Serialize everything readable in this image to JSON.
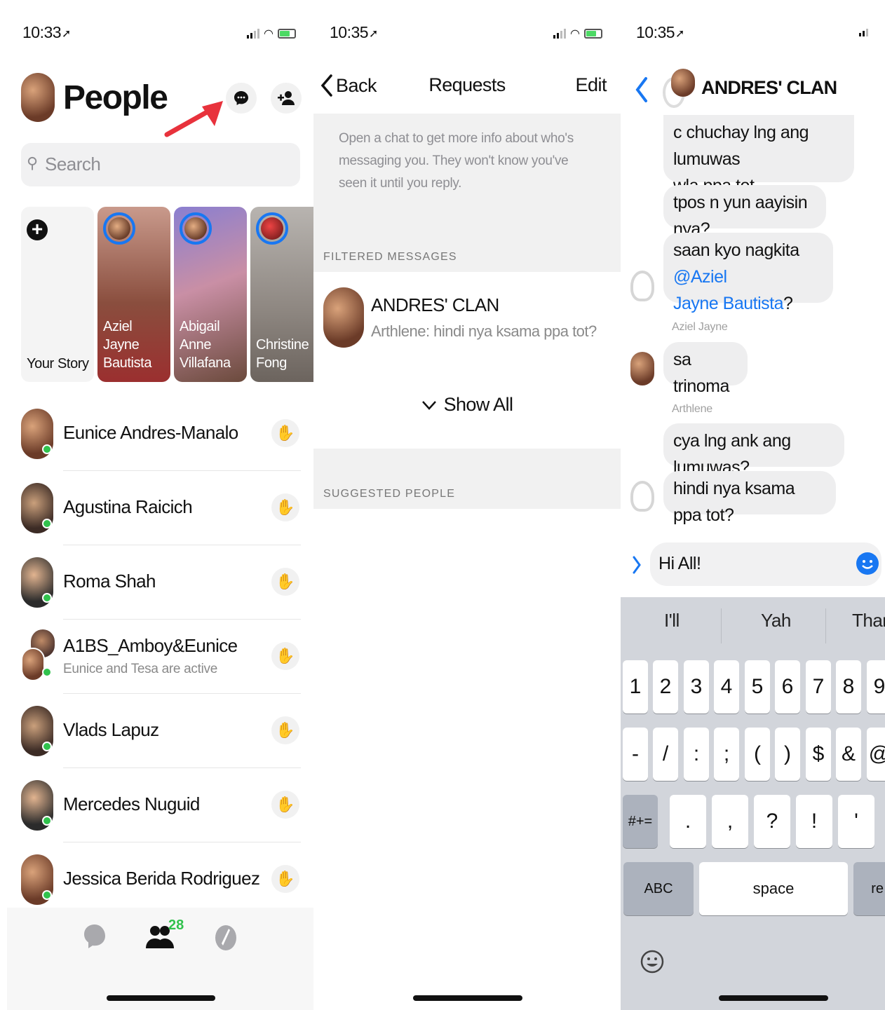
{
  "people_screen": {
    "status_time": "10:33",
    "title": "People",
    "search_placeholder": "Search",
    "stories": [
      {
        "label": "Your Story"
      },
      {
        "label_line1": "Aziel Jayne",
        "label_line2": "Bautista"
      },
      {
        "label_line1": "Abigail",
        "label_line2": "Anne",
        "label_line3": "Villafana"
      },
      {
        "label_line1": "Christine",
        "label_line2": "Fong"
      }
    ],
    "people": [
      {
        "name": "Eunice Andres-Manalo"
      },
      {
        "name": "Agustina Raicich"
      },
      {
        "name": "Roma Shah"
      },
      {
        "name": "A1BS_Amboy&Eunice",
        "subtitle": "Eunice and Tesa are active"
      },
      {
        "name": "Vlads Lapuz"
      },
      {
        "name": "Mercedes Nuguid"
      },
      {
        "name": "Jessica Berida Rodriguez"
      }
    ],
    "tabbar": {
      "people_badge": "28"
    }
  },
  "requests_screen": {
    "status_time": "10:35",
    "back_label": "Back",
    "title": "Requests",
    "edit_label": "Edit",
    "info_text": "Open a chat to get more info about who's messaging you. They won't know you've seen it until you reply.",
    "filtered_header": "FILTERED MESSAGES",
    "filtered_item": {
      "name": "ANDRES' CLAN",
      "preview": "Arthlene: hindi nya ksama ppa tot?"
    },
    "show_all": "Show All",
    "suggested_header": "SUGGESTED PEOPLE"
  },
  "chat_screen": {
    "status_time": "10:35",
    "title": "ANDRES' CLAN",
    "messages": [
      {
        "line1": "c chuchay lng ang lumuwas",
        "line2": "wla ppa tot"
      },
      {
        "text": "tpos n yun aayisin nya?"
      },
      {
        "pre": "saan kyo nagkita ",
        "mention1": "@Aziel",
        "mention2": "Jayne Bautista",
        "post": "?"
      },
      {
        "sender": "Aziel Jayne",
        "text": "sa trinoma"
      },
      {
        "sender": "Arthlene",
        "text": "cya lng ank ang lumuwas?"
      },
      {
        "text": "hindi nya ksama ppa tot?"
      }
    ],
    "input_value": "Hi All!",
    "suggestions": [
      "I'll",
      "Yah",
      "Thar"
    ],
    "keys_row1": [
      "1",
      "2",
      "3",
      "4",
      "5",
      "6",
      "7",
      "8",
      "9"
    ],
    "keys_row2": [
      "-",
      "/",
      ":",
      ";",
      "(",
      ")",
      "$",
      "&",
      "@"
    ],
    "keys_row3": [
      ".",
      ",",
      "?",
      "!",
      "'"
    ],
    "key_symbols": "#+=",
    "key_abc": "ABC",
    "key_space": "space",
    "key_return": "re",
    "colors": {
      "accent": "#1877f2"
    }
  }
}
